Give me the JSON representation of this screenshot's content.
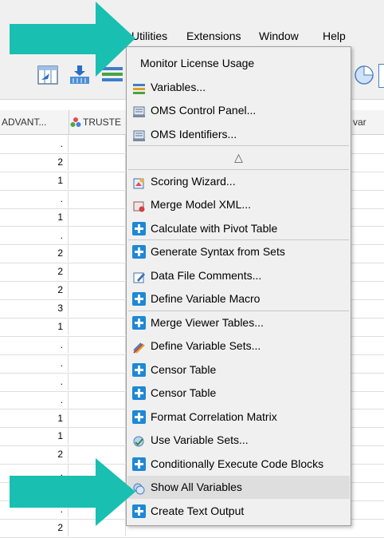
{
  "menubar": {
    "items": [
      {
        "label": "Utilities",
        "underline": "U",
        "rest": "tilities"
      },
      {
        "label": "Extensions",
        "pre": "E",
        "underline": "x",
        "rest": "tensions"
      },
      {
        "label": "Window",
        "underline": "W",
        "rest": "indow"
      },
      {
        "label": "Help",
        "underline": "H",
        "rest": "elp"
      }
    ]
  },
  "grid": {
    "headers": [
      "ADVANT...",
      "TRUSTE",
      "var"
    ],
    "rows": [
      ".",
      "2",
      "1",
      ".",
      "1",
      ".",
      "2",
      "2",
      "2",
      "3",
      "1",
      ".",
      ".",
      ".",
      ".",
      "1",
      "1",
      "2",
      ".",
      ".",
      ".",
      "2"
    ]
  },
  "menu": {
    "items": [
      {
        "label": "Monitor License Usage",
        "icon": "none"
      },
      {
        "label": "Variables...",
        "icon": "variables-icon"
      },
      {
        "label": "OMS Control Panel...",
        "icon": "oms-icon"
      },
      {
        "label": "OMS Identifiers...",
        "icon": "oms-icon"
      },
      {
        "label": "△",
        "icon": "none",
        "center": true
      },
      {
        "label": "Scoring Wizard...",
        "icon": "scoring-icon"
      },
      {
        "label": "Merge Model XML...",
        "icon": "merge-model-icon"
      },
      {
        "label": "Calculate with Pivot Table",
        "icon": "plus-icon"
      },
      {
        "label": "Generate Syntax from Sets",
        "icon": "plus-icon"
      },
      {
        "label": "Data File Comments...",
        "icon": "comments-icon"
      },
      {
        "label": "Define Variable Macro",
        "icon": "plus-icon"
      },
      {
        "label": "Merge Viewer Tables...",
        "icon": "plus-icon"
      },
      {
        "label": "Define Variable Sets...",
        "icon": "variable-sets-icon"
      },
      {
        "label": "Censor Table",
        "icon": "plus-icon"
      },
      {
        "label": "Censor Table",
        "icon": "plus-icon"
      },
      {
        "label": "Format Correlation Matrix",
        "icon": "plus-icon"
      },
      {
        "label": "Use Variable Sets...",
        "icon": "use-sets-icon"
      },
      {
        "label": "Conditionally Execute Code Blocks",
        "icon": "plus-icon"
      },
      {
        "label": "Show All Variables",
        "icon": "show-all-icon",
        "highlighted": true
      },
      {
        "label": "Create Text Output",
        "icon": "plus-icon"
      }
    ]
  },
  "colors": {
    "arrow": "#19bfb0",
    "highlight": "#dedede",
    "plus_icon": "#1e88d6"
  }
}
